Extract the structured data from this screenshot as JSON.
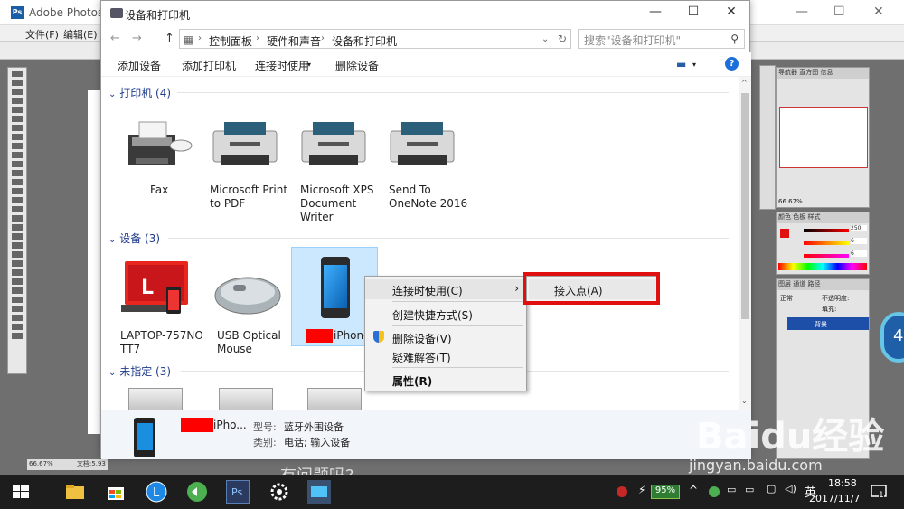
{
  "photoshop": {
    "title": "Adobe Photoshop",
    "menu": [
      "文件(F)",
      "编辑(E)"
    ],
    "zoom": "66.67%",
    "doc_label": "文档:5.93",
    "panel_tabs_top": [
      "导航器",
      "直方图",
      "信息"
    ],
    "nav_zoom": "66.67%",
    "color_tabs": [
      "颜色",
      "色板",
      "样式"
    ],
    "rgb": {
      "r": "250",
      "g": "6",
      "b": "6"
    },
    "layers_tabs": [
      "图层",
      "通道",
      "路径"
    ],
    "blend_mode": "正常",
    "opacity_label": "不透明度:",
    "fill_label": "填充:",
    "layer_name": "背景",
    "badge_number": "4"
  },
  "window": {
    "title": "设备和打印机",
    "controls": {
      "minimize": "—",
      "maximize": "☐",
      "close": "✕"
    }
  },
  "address": {
    "back": "←",
    "forward": "→",
    "up": "↑",
    "crumbs": [
      "控制面板",
      "硬件和声音",
      "设备和打印机"
    ],
    "search_placeholder": "搜索\"设备和打印机\""
  },
  "commands": [
    "添加设备",
    "添加打印机",
    "连接时使用",
    "删除设备"
  ],
  "help": "?",
  "sections": {
    "printers": "打印机 (4)",
    "devices": "设备 (3)",
    "unspecified": "未指定 (3)"
  },
  "printers": [
    {
      "name": "Fax",
      "icon": "fax-icon"
    },
    {
      "name": "Microsoft Print to PDF",
      "icon": "printer-icon"
    },
    {
      "name": "Microsoft XPS Document Writer",
      "icon": "printer-icon"
    },
    {
      "name": "Send To OneNote 2016",
      "icon": "printer-icon"
    }
  ],
  "devices": [
    {
      "name": "LAPTOP-757NOTT7",
      "name_l1": "LAPTOP-757NO",
      "name_l2": "TT7",
      "icon": "laptop-icon"
    },
    {
      "name": "USB Optical Mouse",
      "name_l1": "USB Optical",
      "name_l2": "Mouse",
      "icon": "mouse-icon"
    },
    {
      "name": "iPhone",
      "icon": "phone-icon"
    }
  ],
  "context_menu": {
    "connect_using": "连接时使用(C)",
    "create_shortcut": "创建快捷方式(S)",
    "remove_device": "删除设备(V)",
    "troubleshoot": "疑难解答(T)",
    "properties": "属性(R)"
  },
  "submenu": {
    "access_point": "接入点(A)"
  },
  "details": {
    "device_name": "iPho...",
    "model_label": "型号:",
    "model_value": "蓝牙外围设备",
    "category_label": "类别:",
    "category_value": "电话; 输入设备"
  },
  "taskbar": {
    "battery": "95%",
    "ime": "英",
    "time": "18:58",
    "date": "2017/11/7",
    "notification_count": "1"
  },
  "overlay": {
    "watermark": "Baidu经验",
    "watermark_url": "jingyan.baidu.com",
    "caption_fragment": "有问题吗?"
  },
  "colors": {
    "accent_blue": "#1c6fd8",
    "highlight_red": "#e01010",
    "selection": "#cce8ff"
  }
}
